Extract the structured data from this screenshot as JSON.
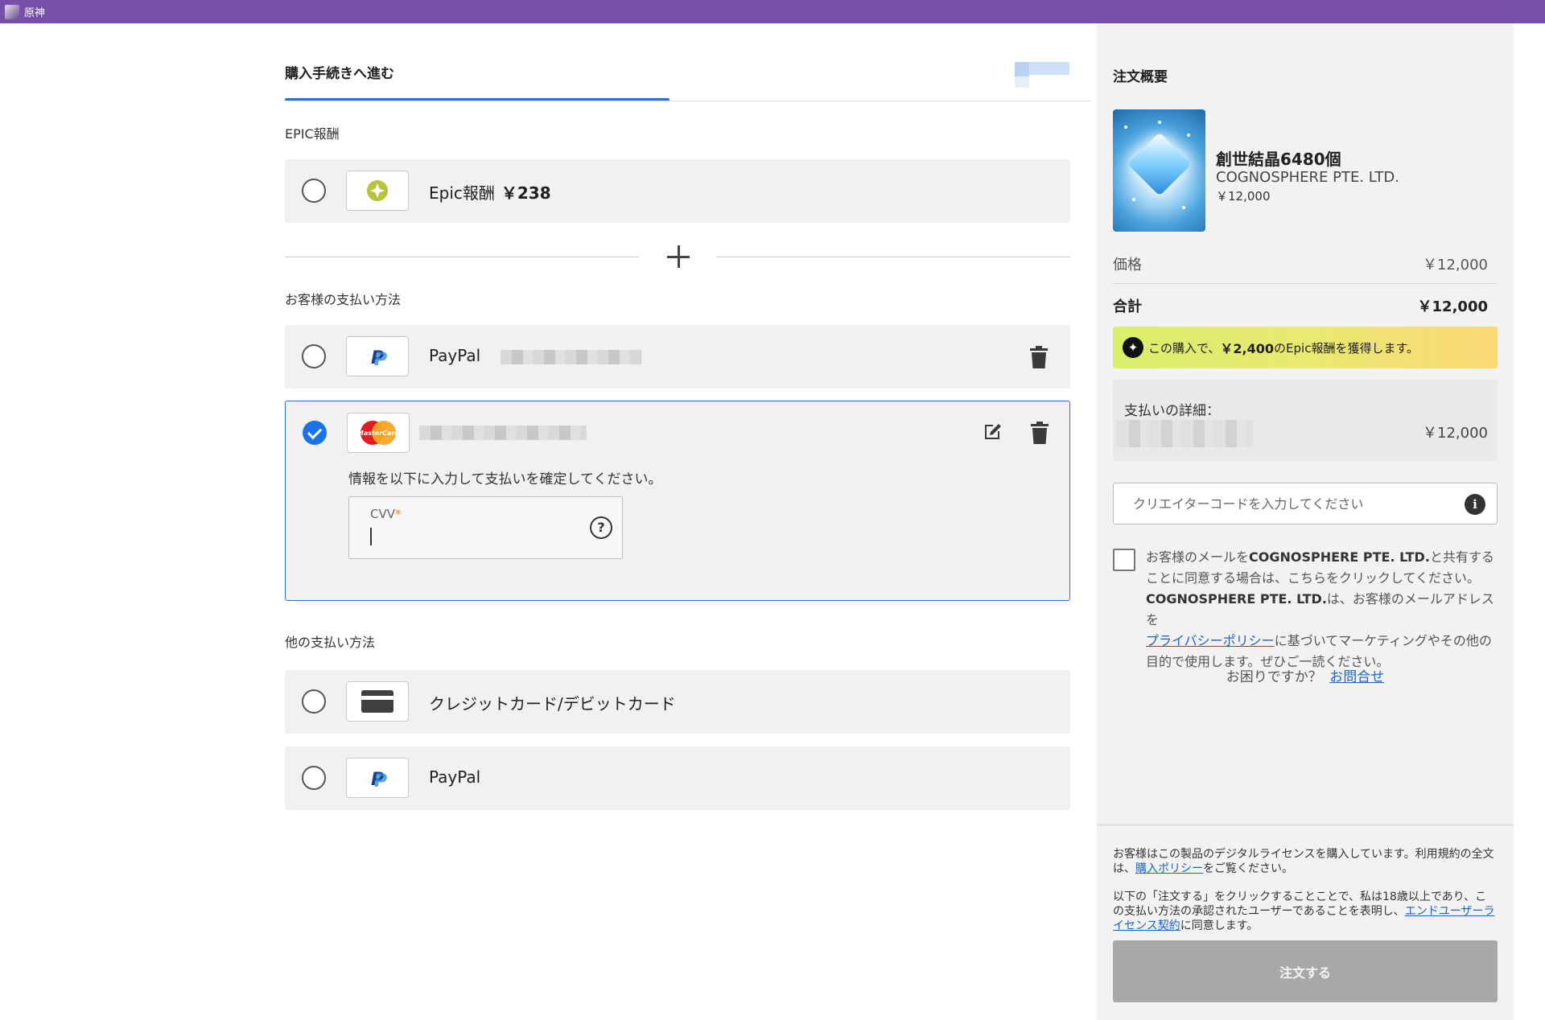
{
  "window": {
    "title": "原神"
  },
  "header": {
    "tab_label": "購入手続きへ進む"
  },
  "epic_rewards": {
    "section_label": "EPIC報酬",
    "method_label": "Epic報酬",
    "amount": "￥238"
  },
  "saved_methods": {
    "section_label": "お客様の支払い方法",
    "paypal": {
      "label": "PayPal"
    },
    "card": {
      "brand": "MasterCard",
      "confirm_text": "情報を以下に入力して支払いを確定してください。",
      "cvv_label": "CVV",
      "cvv_required": "*",
      "cvv_value": ""
    }
  },
  "other_methods": {
    "section_label": "他の支払い方法",
    "items": [
      {
        "label": "クレジットカード/デビットカード"
      },
      {
        "label": "PayPal"
      }
    ]
  },
  "summary": {
    "title": "注文概要",
    "product": {
      "name": "創世結晶6480個",
      "publisher": "COGNOSPHERE PTE. LTD.",
      "price": "￥12,000"
    },
    "price_label": "価格",
    "price_value": "￥12,000",
    "total_label": "合計",
    "total_value": "￥12,000",
    "reward_banner": {
      "prefix": "この購入で、",
      "amount": "￥2,400",
      "suffix": "のEpic報酬を獲得します。"
    },
    "payment_details_label": "支払いの詳細：",
    "payment_details_amount": "￥12,000",
    "creator_code_placeholder": "クリエイターコードを入力してください",
    "consent": {
      "part1": "お客様のメールを",
      "company1": "COGNOSPHERE PTE. LTD.",
      "part2": "と共有することに同意する場合は、こちらをクリックしてください。",
      "company2": "COGNOSPHERE PTE. LTD.",
      "part3": "は、お客様のメールアドレスを",
      "privacy_link": "プライバシーポリシー",
      "part4": "に基づいてマーケティングやその他の目的で使用します。ぜひご一読ください。"
    },
    "help_text": "お困りですか？",
    "help_link": "お問合せ",
    "footer": {
      "license_text": "お客様はこの製品のデジタルライセンスを購入しています。利用規約の全文は、",
      "purchase_policy_link": "購入ポリシー",
      "license_suffix": "をご覧ください。",
      "agree_text": "以下の「注文する」をクリックすることことで、私は18歳以上であり、この支払い方法の承認されたユーザーであることを表明し、",
      "eula_link": "エンドユーザーライセンス契約",
      "agree_suffix": "に同意します。",
      "order_button": "注文する"
    }
  },
  "colors": {
    "titlebar": "#774fa9",
    "accent": "#2276d2",
    "link": "#1b64c4",
    "order_button": "#a8a8a8"
  }
}
